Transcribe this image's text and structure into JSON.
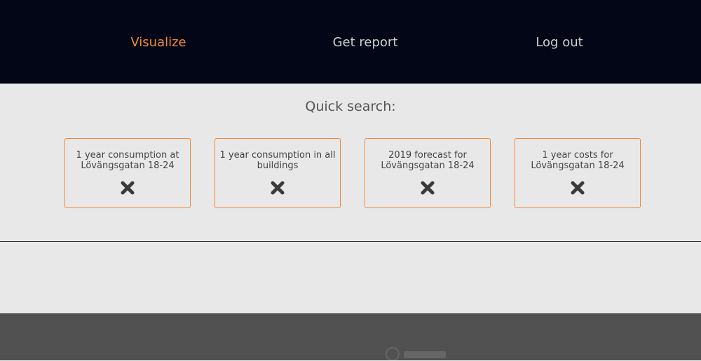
{
  "nav": {
    "items": [
      {
        "label": "Visualize",
        "active": true
      },
      {
        "label": "Get report",
        "active": false
      },
      {
        "label": "Log out",
        "active": false
      }
    ],
    "accent_color": "#f2883a",
    "background_color": "#030616"
  },
  "quick_search": {
    "title": "Quick search:",
    "cards": [
      {
        "label": "1 year consumption at Lövängsgatan 18-24",
        "remove_icon": "close-icon"
      },
      {
        "label": "1 year consumption in all buildings",
        "remove_icon": "close-icon"
      },
      {
        "label": "2019 forecast for Lövängsgatan 18-24",
        "remove_icon": "close-icon"
      },
      {
        "label": "1 year costs for Lövängsgatan 18-24",
        "remove_icon": "close-icon"
      }
    ]
  }
}
